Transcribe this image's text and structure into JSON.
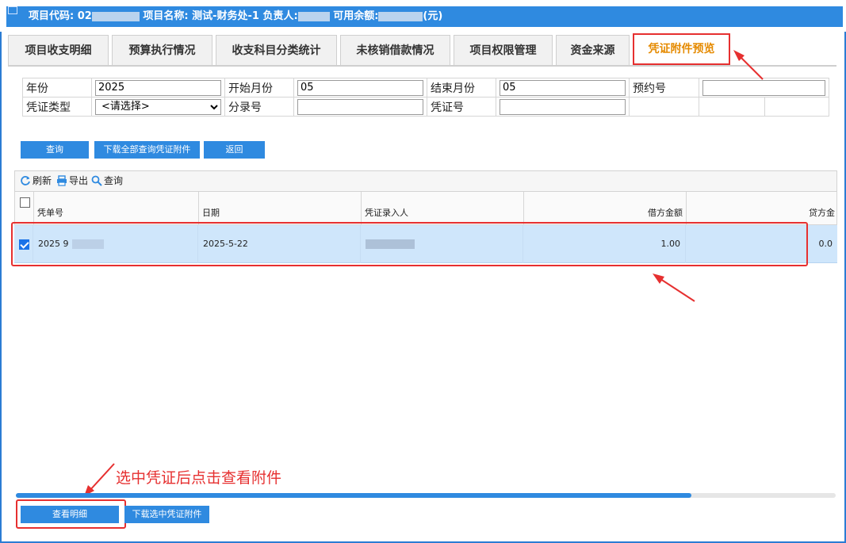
{
  "header": {
    "code_label": "项目代码: 02",
    "name_label": "项目名称: 测试-财务处-1 负责人:",
    "balance_label": "可用余额:",
    "unit": "(元)"
  },
  "tabs": [
    {
      "label": "项目收支明细"
    },
    {
      "label": "预算执行情况"
    },
    {
      "label": "收支科目分类统计"
    },
    {
      "label": "未核销借款情况"
    },
    {
      "label": "项目权限管理"
    },
    {
      "label": "资金来源"
    },
    {
      "label": "凭证附件预览"
    }
  ],
  "filter": {
    "year_label": "年份",
    "year_value": "2025",
    "start_month_label": "开始月份",
    "start_month_value": "05",
    "end_month_label": "结束月份",
    "end_month_value": "05",
    "reserve_no_label": "预约号",
    "reserve_no_value": "",
    "voucher_type_label": "凭证类型",
    "voucher_type_value": "<请选择>",
    "entry_no_label": "分录号",
    "entry_no_value": "",
    "voucher_no_label": "凭证号",
    "voucher_no_value": ""
  },
  "actions": {
    "query": "查询",
    "download_all": "下载全部查询凭证附件",
    "back": "返回"
  },
  "toolbar": {
    "refresh": "刷新",
    "export": "导出",
    "search": "查询"
  },
  "grid": {
    "columns": [
      "凭单号",
      "日期",
      "凭证录入人",
      "借方金额",
      "贷方金"
    ],
    "rows": [
      {
        "voucher": "2025 9",
        "date": "2025-5-22",
        "entered_by": "",
        "debit": "1.00",
        "credit": "0.0",
        "checked": true
      }
    ]
  },
  "hint": "选中凭证后点击查看附件",
  "bottom": {
    "view_detail": "查看明细",
    "download_selected": "下载选中凭证附件"
  },
  "colors": {
    "accent": "#2f8ae0",
    "annotation": "#e63030",
    "active_tab_text": "#e58a00",
    "selected_row": "#cfe6fb"
  }
}
